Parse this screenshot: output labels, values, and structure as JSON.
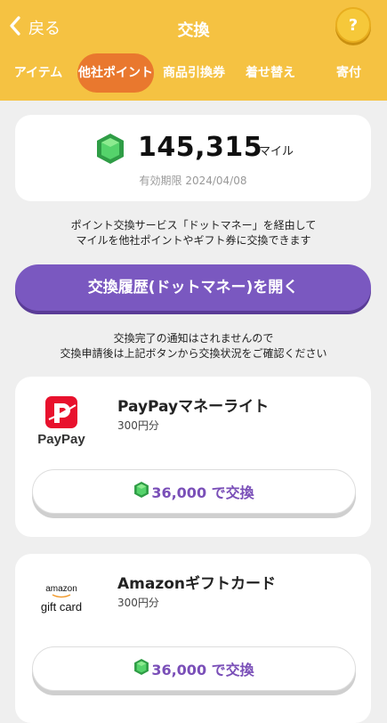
{
  "header": {
    "back_label": "戻る",
    "title": "交換",
    "help_label": "?"
  },
  "tabs": [
    {
      "label": "アイテム",
      "active": false
    },
    {
      "label": "他社ポイント",
      "active": true
    },
    {
      "label": "商品引換券",
      "active": false
    },
    {
      "label": "着せ替え",
      "active": false
    },
    {
      "label": "寄付",
      "active": false
    }
  ],
  "miles": {
    "value": "145,315",
    "unit": "マイル",
    "expiry": "有効期限 2024/04/08"
  },
  "description": {
    "line1": "ポイント交換サービス「ドットマネー」を経由して",
    "line2": "マイルを他社ポイントやギフト券に交換できます"
  },
  "history_button_label": "交換履歴(ドットマネー)を開く",
  "notice": {
    "line1": "交換完了の通知はされませんので",
    "line2": "交換申請後は上記ボタンから交換状況をご確認ください"
  },
  "items": [
    {
      "name": "PayPayマネーライト",
      "amount": "300円分",
      "logo_text": "PayPay",
      "button_label": "36,000 で交換",
      "icon": "paypay-logo"
    },
    {
      "name": "Amazonギフトカード",
      "amount": "300円分",
      "logo_text_top": "amazon",
      "logo_text_bottom": "gift card",
      "button_label": "36,000 で交換",
      "icon": "amazon-gift-card-logo"
    }
  ],
  "colors": {
    "header": "#f5c242",
    "active_tab": "#e9782e",
    "primary_button": "#7a58c0",
    "exchange_text": "#7a4fb8",
    "gem": "#3fbf5a"
  }
}
